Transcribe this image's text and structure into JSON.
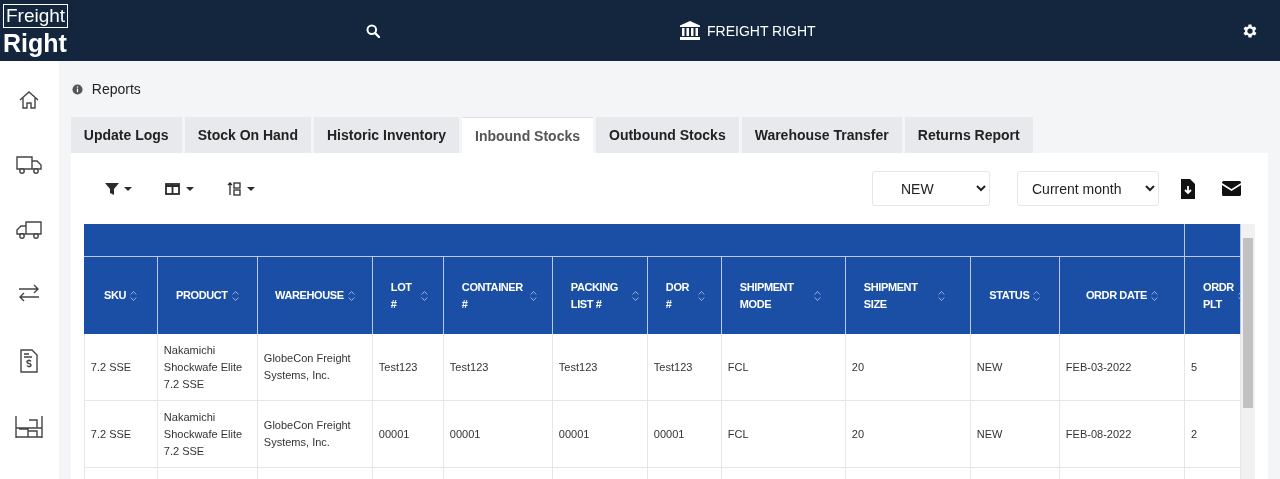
{
  "topbar": {
    "logo_top": "Freight",
    "logo_bottom": "Right",
    "brand": "FREIGHT RIGHT"
  },
  "sidebar": {
    "items": [
      {
        "kind": "home",
        "selected": false
      },
      {
        "kind": "truck",
        "selected": false
      },
      {
        "kind": "delivery",
        "selected": false
      },
      {
        "kind": "transfer",
        "selected": false
      },
      {
        "kind": "invoice",
        "selected": false
      },
      {
        "kind": "warehouse",
        "selected": false
      }
    ]
  },
  "breadcrumb": "Reports",
  "tabs": [
    {
      "label": "Update Logs",
      "selected": false
    },
    {
      "label": "Stock On Hand",
      "selected": false
    },
    {
      "label": "Historic Inventory",
      "selected": false
    },
    {
      "label": "Inbound Stocks",
      "selected": true
    },
    {
      "label": "Outbound Stocks",
      "selected": false
    },
    {
      "label": "Warehouse Transfer",
      "selected": false
    },
    {
      "label": "Returns Report",
      "selected": false
    }
  ],
  "filters": {
    "status": "NEW",
    "period": "Current month"
  },
  "table": {
    "columns": [
      "SKU",
      "PRODUCT",
      "WAREHOUSE",
      "LOT #",
      "CONTAINER #",
      "PACKING LIST #",
      "DOR #",
      "SHIPMENT MODE",
      "SHIPMENT SIZE",
      "STATUS",
      "ORDR DATE",
      "ORDR PLT"
    ],
    "rows": [
      [
        "7.2 SSE",
        "Nakamichi Shockwafe Elite 7.2 SSE",
        "GlobeCon Freight Systems, Inc.",
        "Test123",
        "Test123",
        "Test123",
        "Test123",
        "FCL",
        "20",
        "NEW",
        "FEB-03-2022",
        "5"
      ],
      [
        "7.2 SSE",
        "Nakamichi Shockwafe Elite 7.2 SSE",
        "GlobeCon Freight Systems, Inc.",
        "00001",
        "00001",
        "00001",
        "00001",
        "FCL",
        "20",
        "NEW",
        "FEB-08-2022",
        "2"
      ]
    ]
  }
}
